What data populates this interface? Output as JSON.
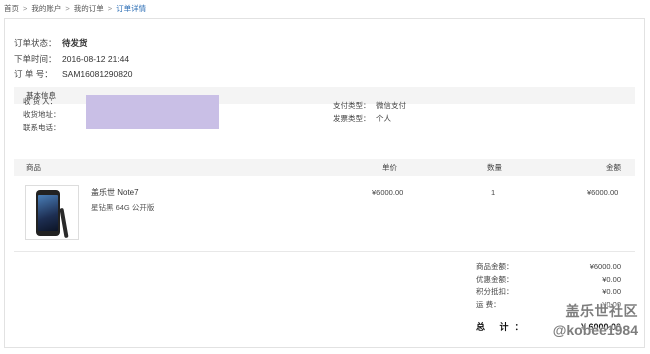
{
  "breadcrumb": {
    "items": [
      "首页",
      "我的账户",
      "我的订单"
    ],
    "current": "订单详情",
    "separator": ">"
  },
  "order": {
    "status_label": "订单状态：",
    "status_value": "待发货",
    "time_label": "下单时间：",
    "time_value": "2016-08-12 21:44",
    "number_label": "订 单 号：",
    "number_value": "SAM16081290820"
  },
  "basic_info": {
    "title": "基本信息",
    "receiver_label": "收 货 人：",
    "address_label": "收货地址：",
    "phone_label": "联系电话：",
    "pay_type_label": "支付类型：",
    "pay_type_value": "微信支付",
    "invoice_type_label": "发票类型：",
    "invoice_type_value": "个人"
  },
  "goods_table": {
    "headers": {
      "product": "商品",
      "price": "单价",
      "quantity": "数量",
      "amount": "金额"
    },
    "items": [
      {
        "name": "盖乐世 Note7",
        "spec": "星钻黑   64G   公开版",
        "price": "¥6000.00",
        "quantity": "1",
        "amount": "¥6000.00"
      }
    ]
  },
  "totals": {
    "goods_amount_label": "商品金额：",
    "goods_amount_value": "¥6000.00",
    "discount_label": "优惠金额：",
    "discount_value": "¥0.00",
    "points_label": "积分抵扣：",
    "points_value": "¥0.00",
    "shipping_label": "运   费：",
    "shipping_value": "¥0.00",
    "grand_label": "总  计：",
    "grand_value": "¥ 6000.00"
  },
  "watermark": {
    "line1": "盖乐世社区",
    "line2": "@kobee1984"
  },
  "colors": {
    "breadcrumb_current": "#2a6db5",
    "section_bg": "#f4f4f4",
    "redaction": "#c9bfe6"
  }
}
